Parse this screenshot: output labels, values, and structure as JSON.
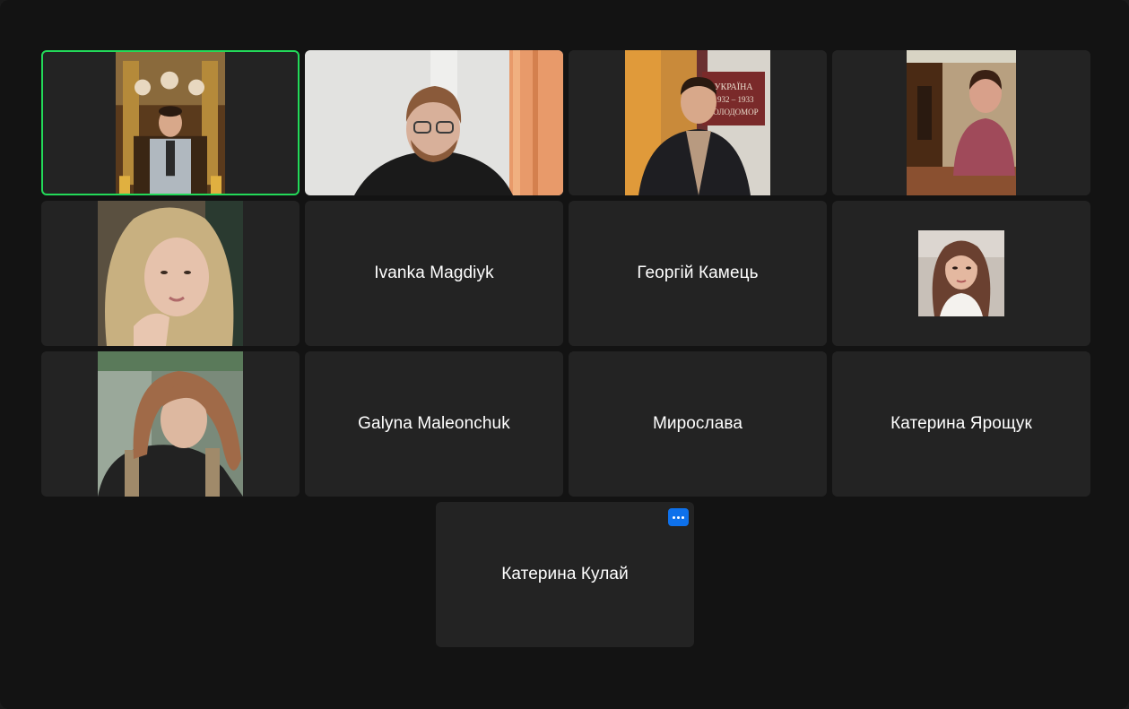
{
  "gallery": {
    "participants": [
      {
        "name": "",
        "video": "ornate-church-interior-man-grey-suit",
        "active": true
      },
      {
        "name": "",
        "video": "bearded-man-glasses-dark-sweater"
      },
      {
        "name": "",
        "video": "man-in-suit-before-memorial-banner"
      },
      {
        "name": "",
        "video": "woman-purple-sweater-at-table"
      },
      {
        "name": "",
        "video": "blonde-woman-head-on-hand"
      },
      {
        "name": "Ivanka Magdiyk"
      },
      {
        "name": "Георгій Камець"
      },
      {
        "name": "",
        "video": "woman-long-hair-white-turtleneck"
      },
      {
        "name": "",
        "video": "woman-looking-down-plaid-top"
      },
      {
        "name": "Galyna Maleonchuk"
      },
      {
        "name": "Мирослава"
      },
      {
        "name": "Катерина Ярощук"
      },
      {
        "name": "Катерина Кулай",
        "has_more_button": true
      }
    ],
    "banner_text": "УКРАЇНА 1932 – 1933 ГОЛОДОМОР"
  },
  "colors": {
    "window_bg": "#131313",
    "tile_bg": "#232323",
    "active_speaker_border": "#23d959",
    "more_button": "#0e71eb"
  },
  "icons": {
    "more_button": "ellipsis-icon"
  }
}
